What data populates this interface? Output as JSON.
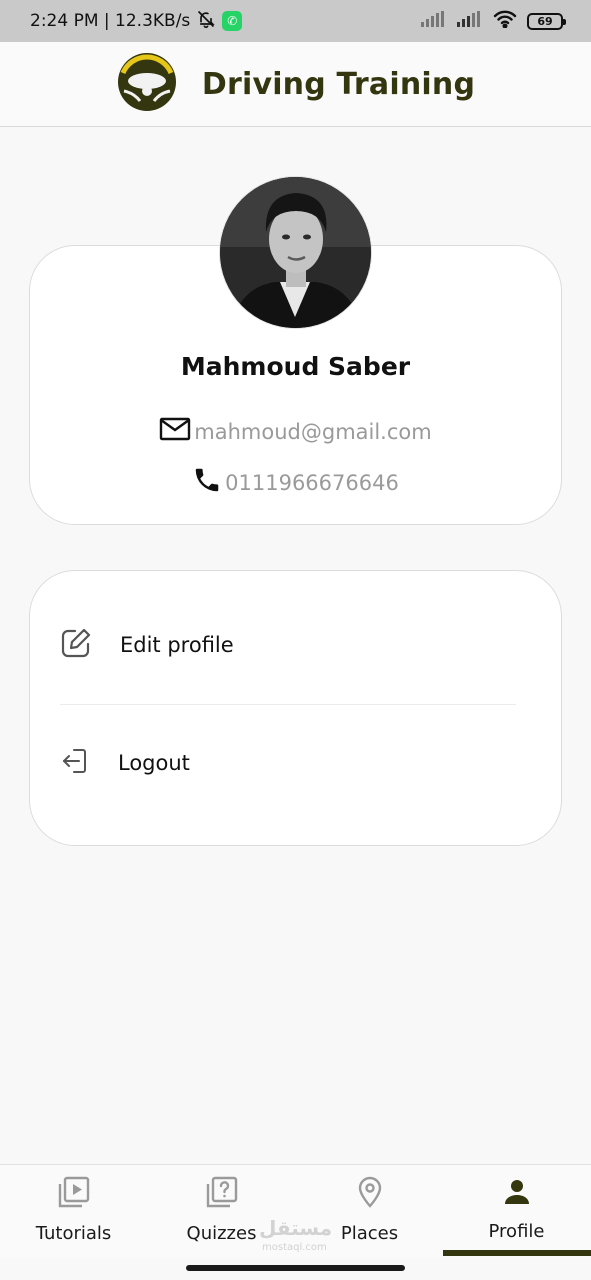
{
  "status_bar": {
    "time_speed": "2:24 PM | 12.3KB/s",
    "battery": "69"
  },
  "app_bar": {
    "title": "Driving Training",
    "logo_icon": "steering-wheel-icon"
  },
  "profile": {
    "name": "Mahmoud Saber",
    "email": "mahmoud@gmail.com",
    "phone": "0111966676646"
  },
  "menu": {
    "edit_label": "Edit profile",
    "logout_label": "Logout"
  },
  "bottom_nav": {
    "items": [
      {
        "label": "Tutorials",
        "icon": "video-library-icon"
      },
      {
        "label": "Quizzes",
        "icon": "quiz-icon"
      },
      {
        "label": "Places",
        "icon": "location-pin-icon"
      },
      {
        "label": "Profile",
        "icon": "person-icon"
      }
    ],
    "active_index": 3
  },
  "watermark": {
    "text": "مستقل",
    "sub": "mostaql.com"
  },
  "colors": {
    "brand": "#34360f",
    "accent_gold": "#e6c619",
    "text_muted": "#9a9a9a"
  }
}
